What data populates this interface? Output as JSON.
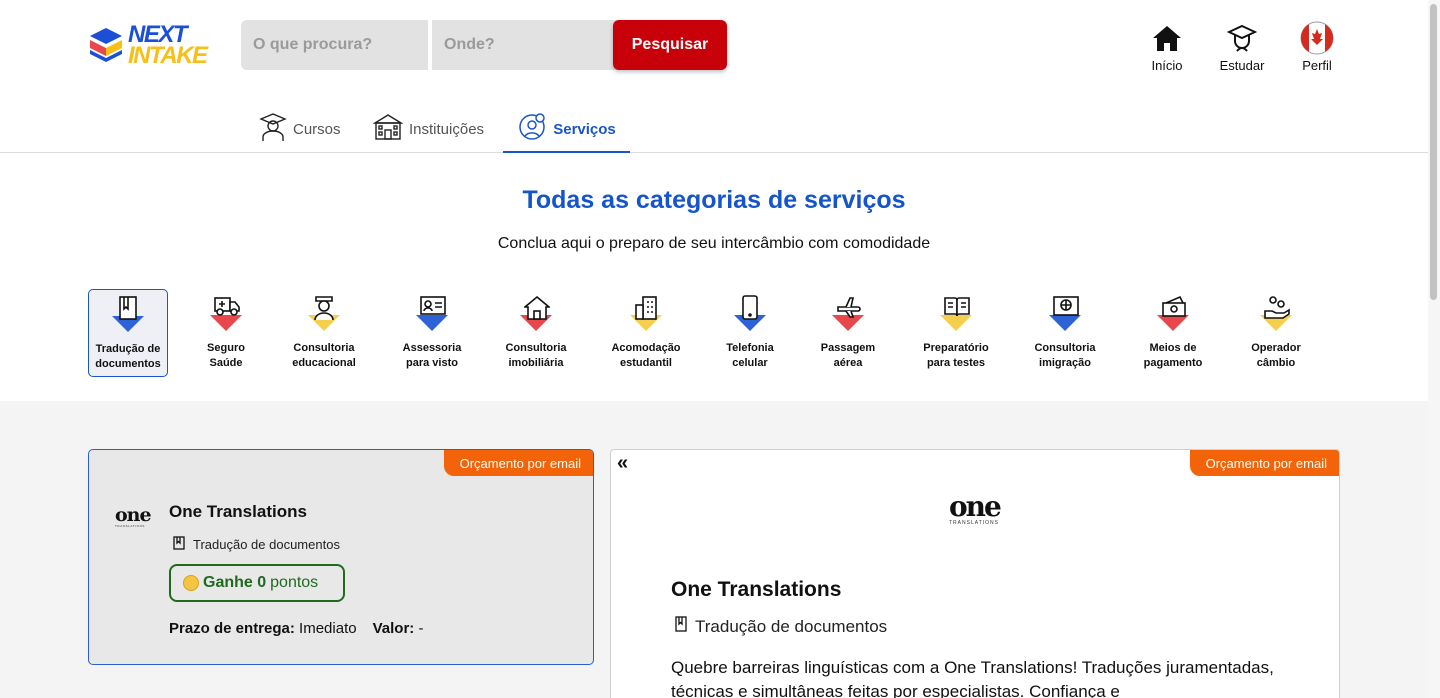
{
  "brand": {
    "line1": "NEXT",
    "line2": "INTAKE"
  },
  "search": {
    "what_placeholder": "O que procura?",
    "where_placeholder": "Onde?",
    "button_label": "Pesquisar"
  },
  "topnav": {
    "inicio": "Início",
    "estudar": "Estudar",
    "perfil": "Perfil"
  },
  "tabs": {
    "cursos": "Cursos",
    "instituicoes": "Instituições",
    "servicos": "Serviços"
  },
  "section": {
    "title": "Todas as categorias de serviços",
    "subtitle": "Conclua aqui o preparo de seu intercâmbio com comodidade"
  },
  "categories": [
    {
      "line1": "Tradução de",
      "line2": "documentos",
      "color": "#2d63d6"
    },
    {
      "line1": "Seguro",
      "line2": "Saúde",
      "color": "#e8484c"
    },
    {
      "line1": "Consultoria",
      "line2": "educacional",
      "color": "#f6d04d"
    },
    {
      "line1": "Assessoria",
      "line2": "para visto",
      "color": "#2d63d6"
    },
    {
      "line1": "Consultoria",
      "line2": "imobiliária",
      "color": "#e8484c"
    },
    {
      "line1": "Acomodação",
      "line2": "estudantil",
      "color": "#f6d04d"
    },
    {
      "line1": "Telefonia",
      "line2": "celular",
      "color": "#2d63d6"
    },
    {
      "line1": "Passagem",
      "line2": "aérea",
      "color": "#e8484c"
    },
    {
      "line1": "Preparatório",
      "line2": "para testes",
      "color": "#f6d04d"
    },
    {
      "line1": "Consultoria",
      "line2": "imigração",
      "color": "#2d63d6"
    },
    {
      "line1": "Meios de",
      "line2": "pagamento",
      "color": "#e8484c"
    },
    {
      "line1": "Operador",
      "line2": "câmbio",
      "color": "#f6d04d"
    }
  ],
  "listing": {
    "badge": "Orçamento por email",
    "name": "One Translations",
    "category": "Tradução de documentos",
    "points_prefix": "Ganhe 0",
    "points_suffix": "pontos",
    "deadline_label": "Prazo de entrega:",
    "deadline_value": "Imediato",
    "value_label": "Valor:",
    "value_value": "-"
  },
  "detail": {
    "back": "«",
    "badge": "Orçamento por email",
    "name": "One Translations",
    "category": "Tradução de documentos",
    "description": "Quebre barreiras linguísticas com a One Translations! Traduções juramentadas, técnicas e simultâneas feitas por especialistas. Confiança e"
  },
  "logo_text": {
    "main": "one",
    "tagline": "TRANSLATIONS"
  }
}
